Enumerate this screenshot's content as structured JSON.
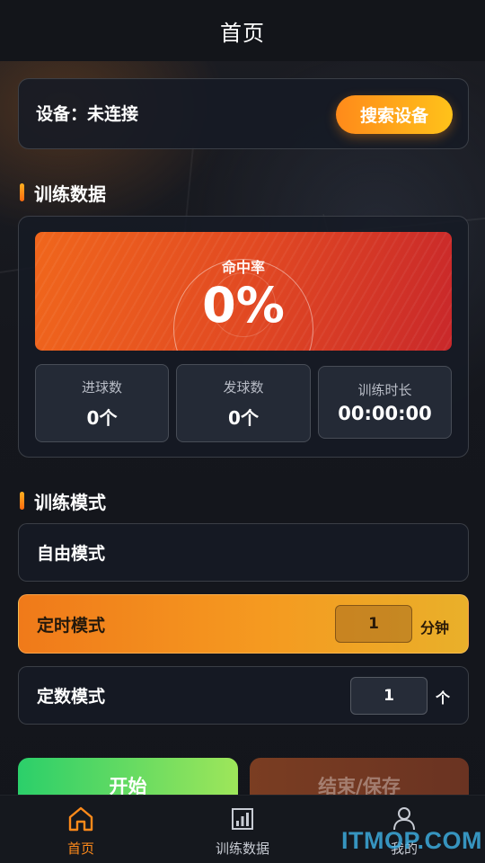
{
  "header": {
    "title": "首页"
  },
  "device": {
    "label": "设备：未连接",
    "search_button": "搜索设备"
  },
  "sections": {
    "training_data": "训练数据",
    "training_mode": "训练模式"
  },
  "stats": {
    "hit_rate_label": "命中率",
    "hit_rate_value": "0%",
    "goals_label": "进球数",
    "goals_value": "0个",
    "shots_label": "发球数",
    "shots_value": "0个",
    "duration_label": "训练时长",
    "duration_value": "00:00:00"
  },
  "modes": {
    "free": {
      "label": "自由模式"
    },
    "timed": {
      "label": "定时模式",
      "value": "1",
      "unit": "分钟",
      "active": true
    },
    "count": {
      "label": "定数模式",
      "value": "1",
      "unit": "个"
    }
  },
  "actions": {
    "start": "开始",
    "end": "结束/保存"
  },
  "tabbar": {
    "items": [
      {
        "label": "首页",
        "icon": "home-icon",
        "active": true
      },
      {
        "label": "训练数据",
        "icon": "bar-chart-icon"
      },
      {
        "label": "我的",
        "icon": "user-icon"
      }
    ]
  },
  "watermark": "ITMOP.COM",
  "colors": {
    "accent": "#ff8a1a",
    "start_green": "#2bcf6a",
    "hit_red": "#e24a22"
  }
}
